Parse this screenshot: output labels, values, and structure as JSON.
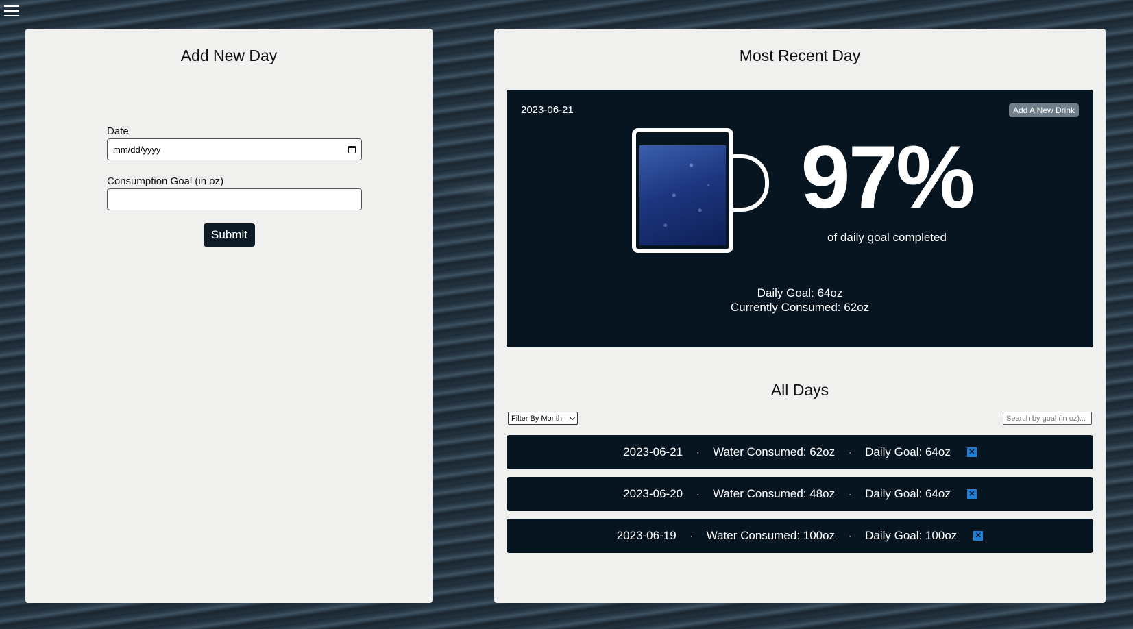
{
  "nav": {
    "menu_icon": "hamburger-menu-icon"
  },
  "add_day": {
    "title": "Add New Day",
    "date_label": "Date",
    "date_placeholder": "mm/dd/yyyy",
    "goal_label": "Consumption Goal (in oz)",
    "goal_value": "",
    "submit_label": "Submit"
  },
  "recent": {
    "title": "Most Recent Day",
    "date": "2023-06-21",
    "add_drink_label": "Add A New Drink",
    "percent_text": "97%",
    "percent_caption": "of daily goal completed",
    "daily_goal_text": "Daily Goal: 64oz",
    "consumed_text": "Currently Consumed: 62oz",
    "fill_level": 0.97,
    "mug_icon": "water-mug-icon"
  },
  "all_days": {
    "title": "All Days",
    "filter_label": "Filter By Month",
    "search_placeholder": "Search by goal (in oz)...",
    "separator": "·",
    "rows": [
      {
        "date": "2023-06-21",
        "consumed": "Water Consumed: 62oz",
        "goal": "Daily Goal: 64oz",
        "delete_icon": "✕"
      },
      {
        "date": "2023-06-20",
        "consumed": "Water Consumed: 48oz",
        "goal": "Daily Goal: 64oz",
        "delete_icon": "✕"
      },
      {
        "date": "2023-06-19",
        "consumed": "Water Consumed: 100oz",
        "goal": "Daily Goal: 100oz",
        "delete_icon": "✕"
      }
    ]
  },
  "colors": {
    "card_bg": "#061520",
    "panel_bg": "#f0f0ee",
    "delete_blue": "#1e7fd6",
    "button_grey": "#6f7e89"
  }
}
